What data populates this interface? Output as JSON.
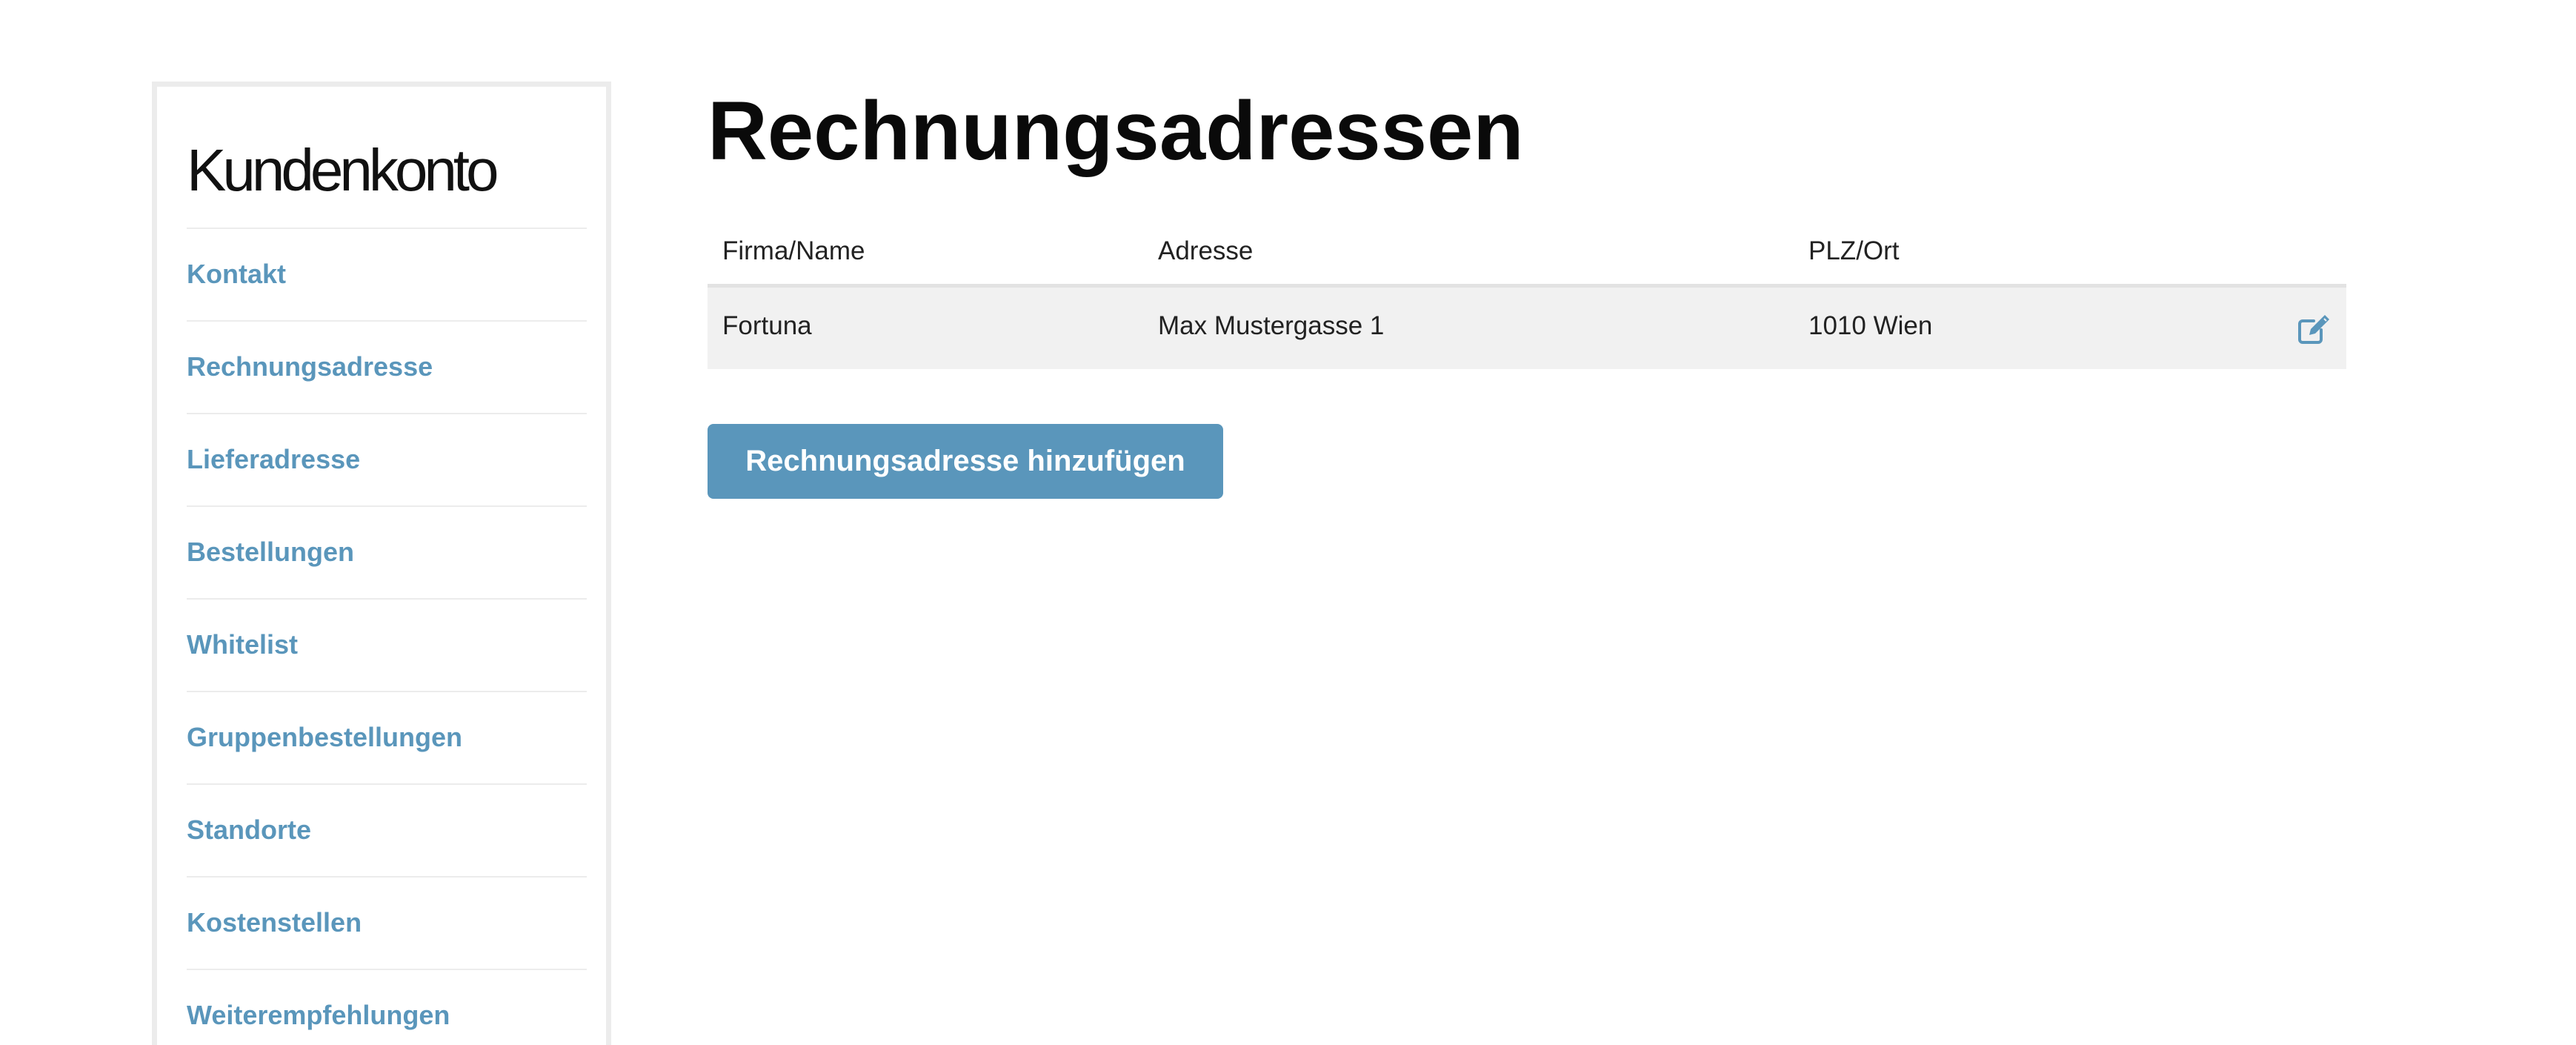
{
  "sidebar": {
    "title": "Kundenkonto",
    "items": [
      {
        "label": "Kontakt"
      },
      {
        "label": "Rechnungsadresse"
      },
      {
        "label": "Lieferadresse"
      },
      {
        "label": "Bestellungen"
      },
      {
        "label": "Whitelist"
      },
      {
        "label": "Gruppenbestellungen"
      },
      {
        "label": "Standorte"
      },
      {
        "label": "Kostenstellen"
      },
      {
        "label": "Weiterempfehlungen"
      }
    ]
  },
  "main": {
    "title": "Rechnungsadressen",
    "table": {
      "headers": [
        "Firma/Name",
        "Adresse",
        "PLZ/Ort"
      ],
      "rows": [
        {
          "name": "Fortuna",
          "street": "Max Mustergasse 1",
          "city": "1010 Wien",
          "action_icon": "edit-icon"
        }
      ]
    },
    "add_button_label": "Rechnungsadresse hinzufügen"
  },
  "colors": {
    "accent": "#5a96bb",
    "row_background": "#f1f1f1",
    "border": "#ececec"
  }
}
